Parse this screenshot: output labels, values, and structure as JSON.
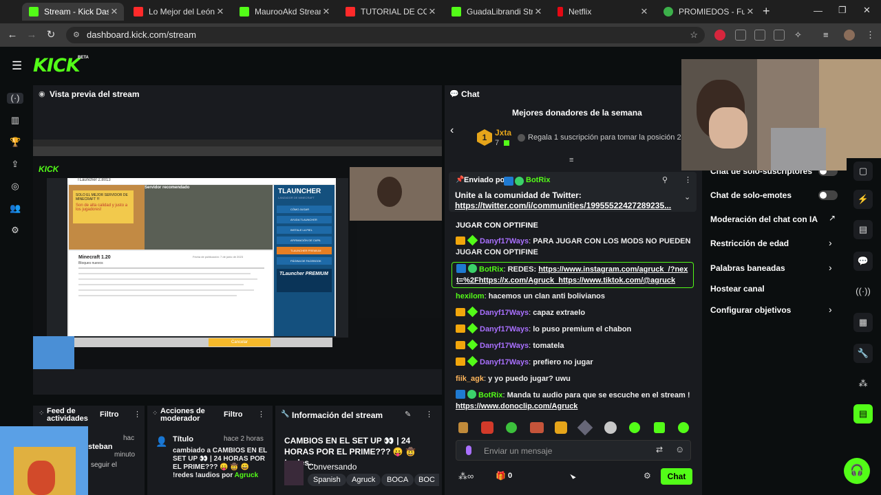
{
  "browser": {
    "tabs": [
      {
        "label": "Stream - Kick Dashboard",
        "fav": "#53fc18",
        "active": true
      },
      {
        "label": "Lo Mejor del León León",
        "fav": "#ff2a2a"
      },
      {
        "label": "MaurooAkd Stream - Vi",
        "fav": "#53fc18"
      },
      {
        "label": "TUTORIAL DE COMO IN",
        "fav": "#ff2a2a"
      },
      {
        "label": "GuadaLibrandi Stream",
        "fav": "#53fc18"
      },
      {
        "label": "Netflix",
        "fav": "#e50914"
      },
      {
        "label": "PROMIEDOS - Futbol A",
        "fav": "#3cb04a"
      }
    ],
    "new_tab": "+",
    "url": "dashboard.kick.com/stream"
  },
  "header": {
    "logo": "KICK",
    "beta": "BETA"
  },
  "preview": {
    "title": "Vista previa del stream",
    "inner": {
      "window_title": "TLauncher 2.8013",
      "server_title": "Servidor recomendado",
      "server_tag": "SOLO EL MEJOR SERVIDOR DE MINECRAFT !!!",
      "server_tag2": "Son de alta calidad y justo a los jugadores!",
      "brand": "TLAUNCHER",
      "brand_sub": "LANZADOR DE MINECRAFT",
      "menu": [
        "CÓMO JUGAR",
        "AYUDA TLAUNCHER",
        "INSTALE LA PIEL",
        "AFIRMACIÓN DE CAPA",
        "TLAUNCHER PREMIUM",
        "PÁGINA DE FACEBOOK"
      ],
      "premium": "TLauncher PREMIUM",
      "version_title": "Minecraft 1.20",
      "version_sub": "Bloques nuevos",
      "date": "Fecha de publicación: 7 de junio de 2023",
      "cancel": "Cancelar"
    }
  },
  "chat": {
    "title": "Chat",
    "donors_title": "Mejores donadores de la semana",
    "donor_name": "Jxta",
    "donor_count": "7",
    "donor_rank": "1",
    "donor_hint": "Regala 1 suscripción para tomar la posición 2",
    "pinned_by": "Enviado por",
    "pinned_user": "BotRix",
    "pinned_text": "Unite a la comunidad de Twitter:",
    "pinned_link": "https://twitter.com/i/communities/19955522427289235...",
    "partial_top": "JUGAR CON OPTIFINE",
    "messages": [
      {
        "user": "Danyf17Ways",
        "text": "PARA JUGAR CON LOS MODS NO PUEDEN JUGAR CON OPTIFINE"
      },
      {
        "user": "BotRix",
        "text": "REDES:",
        "link": "https://www.instagram.com/agruck_/?next=%2Fhttps://x.com/Agruck_https://www.tiktok.com/@agruck"
      },
      {
        "user": "hexilom",
        "text": "hacemos un clan anti bolivianos"
      },
      {
        "user": "Danyf17Ways",
        "text": "capaz extraelo"
      },
      {
        "user": "Danyf17Ways",
        "text": "lo puso premium el chabon"
      },
      {
        "user": "Danyf17Ways",
        "text": "tomatela"
      },
      {
        "user": "Danyf17Ways",
        "text": "prefiero no jugar"
      },
      {
        "user": "fiik_agk",
        "text": "y yo puedo jugar? uwu"
      },
      {
        "user": "BotRix",
        "text": "Manda tu audio para que se escuche en el stream !",
        "link": "https://www.donoclip.com/Agruck"
      }
    ],
    "input_placeholder": "Enviar un mensaje",
    "count": "0",
    "send": "Chat"
  },
  "settings": {
    "items": [
      {
        "label": "Chat de solo-suscriptores",
        "kind": "toggle"
      },
      {
        "label": "Chat de solo-emotes",
        "kind": "toggle"
      },
      {
        "label": "Moderación del chat con IA",
        "kind": "external"
      },
      {
        "label": "Restricción de edad",
        "kind": "chevron"
      },
      {
        "label": "Palabras baneadas",
        "kind": "chevron"
      },
      {
        "label": "Hostear canal",
        "kind": "none"
      },
      {
        "label": "Configurar objetivos",
        "kind": "chevron"
      }
    ]
  },
  "activity": {
    "title": "Feed de actividades",
    "filter": "Filtro",
    "lines": [
      "hac",
      "steban",
      "minuto",
      "seguir el"
    ]
  },
  "modactions": {
    "title": "Acciones de moderador",
    "filter": "Filtro",
    "entry_label": "Título",
    "entry_time": "hace 2 horas",
    "entry_text": "cambiado a CAMBIOS EN EL SET UP 👀 | 24 HORAS POR EL PRIME??? 😛 🤠 😀 !redes !audios por",
    "entry_user": "Agruck"
  },
  "streaminfo": {
    "title": "Información del stream",
    "stream_title": "CAMBIOS EN EL SET UP 👀 | 24 HORAS POR EL PRIME??? 😛 🤠 !redes...",
    "category": "Conversando",
    "tags": [
      "Spanish",
      "Agruck",
      "BOCA",
      "BOC"
    ]
  },
  "colors": {
    "accent": "#53fc18",
    "panel": "#191b1f",
    "bg": "#0b0e0f",
    "purple": "#a970ff"
  }
}
